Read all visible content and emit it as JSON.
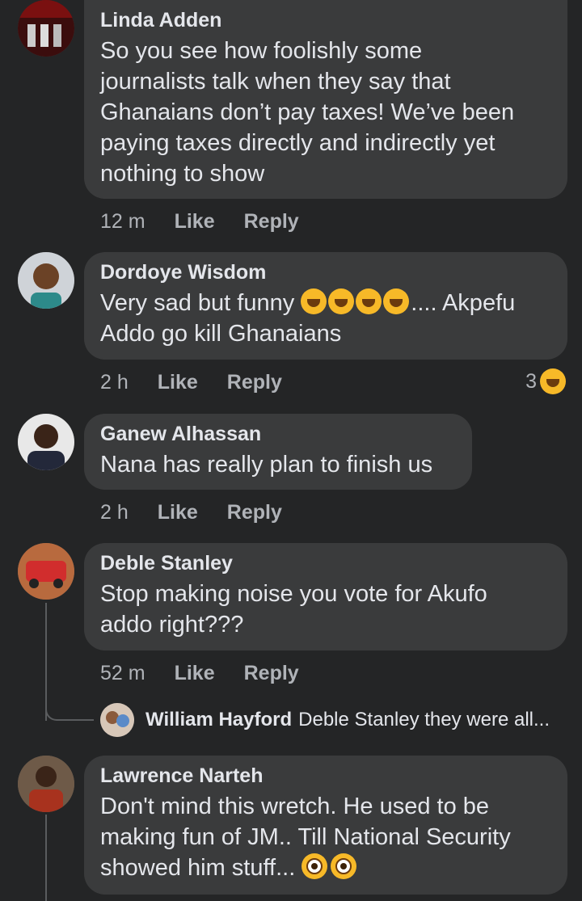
{
  "comments": [
    {
      "author": "Linda Adden",
      "lines": [
        "So you see how foolishly some",
        "journalists talk when they say that",
        "Ghanaians don’t pay taxes! We’ve been",
        "paying taxes directly and indirectly yet",
        "nothing to show"
      ],
      "time": "12 m",
      "like": "Like",
      "reply": "Reply"
    },
    {
      "author": "Dordoye Wisdom",
      "line1_prefix": "Very sad but funny",
      "line1_suffix": ".... Akpefu",
      "line2": "Addo go kill Ghanaians",
      "emoji": "rolling-on-floor-laughing",
      "time": "2 h",
      "like": "Like",
      "reply": "Reply",
      "reaction_count": "3",
      "reaction_emoji": "laughing"
    },
    {
      "author": "Ganew Alhassan",
      "lines": [
        "Nana has really plan to finish us"
      ],
      "time": "2 h",
      "like": "Like",
      "reply": "Reply"
    },
    {
      "author": "Deble Stanley",
      "lines": [
        "Stop making noise you vote for Akufo",
        "addo right???"
      ],
      "time": "52 m",
      "like": "Like",
      "reply": "Reply",
      "reply_preview": {
        "name": "William Hayford",
        "text": "Deble Stanley they were all..."
      }
    },
    {
      "author": "Lawrence Narteh",
      "lines": [
        "Don't mind this wretch. He used to be",
        "making fun of JM.. Till National Security"
      ],
      "last_line": "showed him stuff...",
      "emoji": "eyes"
    }
  ],
  "colors": {
    "background": "#242526",
    "bubble": "#3a3b3c",
    "text": "#e4e6eb",
    "meta": "#b0b3b8"
  }
}
